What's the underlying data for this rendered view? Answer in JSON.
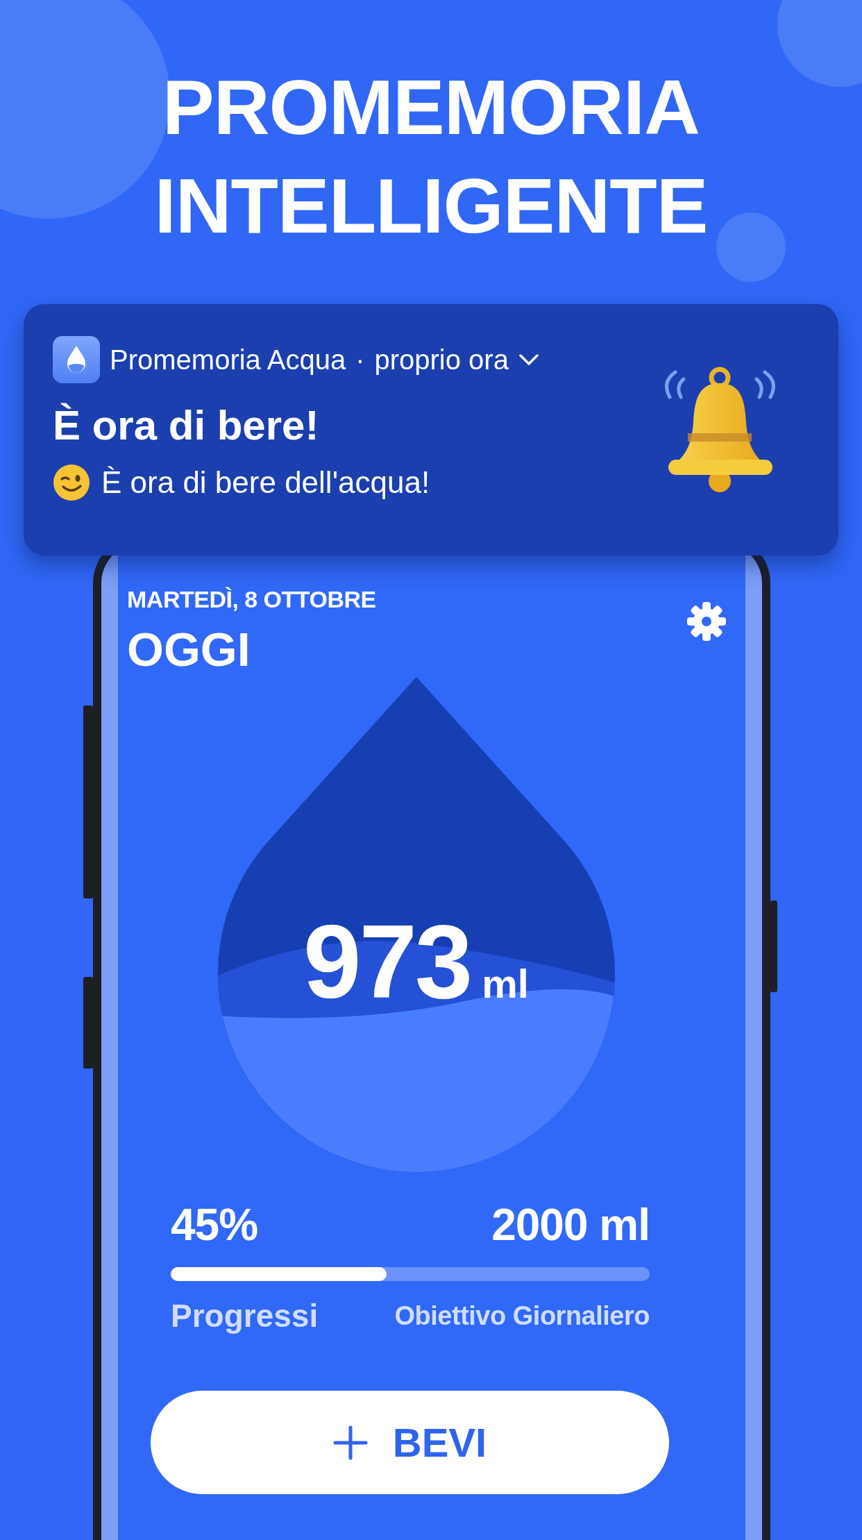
{
  "headline": [
    "PROMEMORIA",
    "INTELLIGENTE"
  ],
  "notification": {
    "app_name": "Promemoria Acqua",
    "separator": "·",
    "time": "proprio ora",
    "title": "È ora di bere!",
    "body": "È ora di bere dell'acqua!"
  },
  "screen": {
    "date": "MARTEDÌ, 8 OTTOBRE",
    "title": "OGGI",
    "intake": {
      "amount": "973",
      "unit": "ml"
    },
    "progress": {
      "percent": "45%",
      "goal": "2000 ml",
      "level": 0.45,
      "percent_label": "Progressi",
      "goal_label": "Obiettivo Giornaliero"
    },
    "drink_button": {
      "label": "BEVI"
    }
  }
}
